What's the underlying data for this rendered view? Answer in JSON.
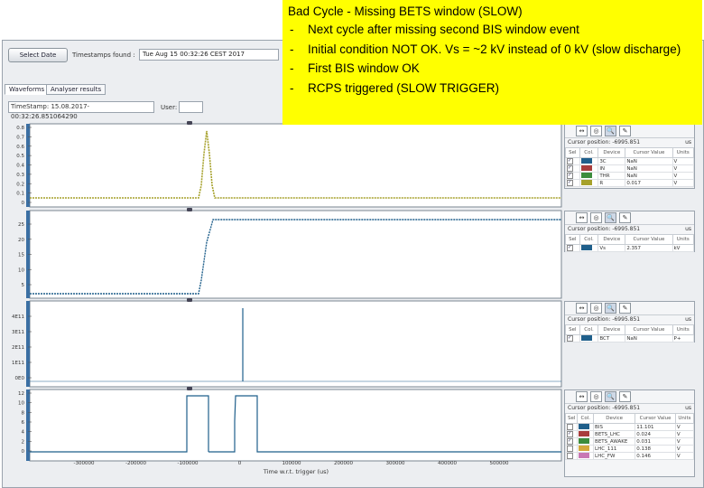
{
  "note": {
    "title": "Bad Cycle - Missing BETS window (SLOW)",
    "bullets": [
      "Next cycle after missing second BIS window event",
      "Initial condition NOT OK. Vs = ~2 kV instead of 0 kV (slow discharge)",
      "First BIS window OK",
      "RCPS triggered (SLOW TRIGGER)"
    ]
  },
  "toolbar": {
    "select_date": "Select Date",
    "timestamps_label": "Timestamps found :",
    "timestamp_value": "Tue Aug 15 00:32:26 CEST 2017"
  },
  "tabs": [
    "Waveforms",
    "Analyser results"
  ],
  "info": {
    "timestamp_label": "TimeStamp:",
    "timestamp_value": "15.08.2017-00:32:26.851064290",
    "user_label": "User:"
  },
  "charts": [
    {
      "ticks": [
        "0.8",
        "0.7",
        "0.6",
        "0.5",
        "0.4",
        "0.3",
        "0.2",
        "0.1",
        "0"
      ],
      "color": "#a6a12b"
    },
    {
      "ticks": [
        "25",
        "20",
        "15",
        "10",
        "5"
      ],
      "color": "#1f5f8b"
    },
    {
      "ticks": [
        "4E11",
        "3E11",
        "2E11",
        "1E11",
        "0E0"
      ],
      "color": "#1f5f8b"
    },
    {
      "ticks": [
        "12",
        "10",
        "8",
        "6",
        "4",
        "2",
        "0"
      ],
      "color": "#1f5f8b"
    }
  ],
  "x_axis": {
    "ticks": [
      "-300000",
      "-200000",
      "-100000",
      "0",
      "100000",
      "200000",
      "300000",
      "400000",
      "500000"
    ],
    "label": "Time w.r.t. trigger (us)"
  },
  "panels": [
    {
      "cursor": "Cursor position: -6995.851",
      "unit": "us",
      "headers": [
        "Sel",
        "Col.",
        "Device",
        "Cursor Value",
        "Units"
      ],
      "rows": [
        {
          "checked": true,
          "color": "#1f5f8b",
          "device": "3C",
          "value": "NaN",
          "unit": "V"
        },
        {
          "checked": true,
          "color": "#a83c3c",
          "device": "IN",
          "value": "NaN",
          "unit": "V"
        },
        {
          "checked": true,
          "color": "#3c8c3c",
          "device": "THR",
          "value": "NaN",
          "unit": "V"
        },
        {
          "checked": true,
          "color": "#a6a12b",
          "device": "R",
          "value": "0.017",
          "unit": "V"
        }
      ]
    },
    {
      "cursor": "Cursor position: -6995.851",
      "unit": "us",
      "headers": [
        "Sel",
        "Col.",
        "Device",
        "Cursor Value",
        "Units"
      ],
      "rows": [
        {
          "checked": true,
          "color": "#1f5f8b",
          "device": "Vs",
          "value": "2.357",
          "unit": "kV"
        }
      ]
    },
    {
      "cursor": "Cursor position: -6995.851",
      "unit": "us",
      "headers": [
        "Sel",
        "Col.",
        "Device",
        "Cursor Value",
        "Units"
      ],
      "rows": [
        {
          "checked": true,
          "color": "#1f5f8b",
          "device": "BCT",
          "value": "NaN",
          "unit": "P+"
        }
      ]
    },
    {
      "cursor": "Cursor position: -6995.851",
      "unit": "us",
      "headers": [
        "Sel",
        "Col.",
        "Device",
        "Cursor Value",
        "Units"
      ],
      "rows": [
        {
          "checked": false,
          "color": "#1f5f8b",
          "device": "BIS",
          "value": "11.101",
          "unit": "V"
        },
        {
          "checked": true,
          "color": "#a83c3c",
          "device": "BETS_LHC",
          "value": "0.024",
          "unit": "V"
        },
        {
          "checked": true,
          "color": "#3c8c3c",
          "device": "BETS_AWAKE",
          "value": "0.031",
          "unit": "V"
        },
        {
          "checked": false,
          "color": "#d4a93c",
          "device": "LHC_111",
          "value": "0.138",
          "unit": "V"
        },
        {
          "checked": false,
          "color": "#c878b4",
          "device": "LHC_FW",
          "value": "0.146",
          "unit": "V"
        }
      ]
    }
  ]
}
